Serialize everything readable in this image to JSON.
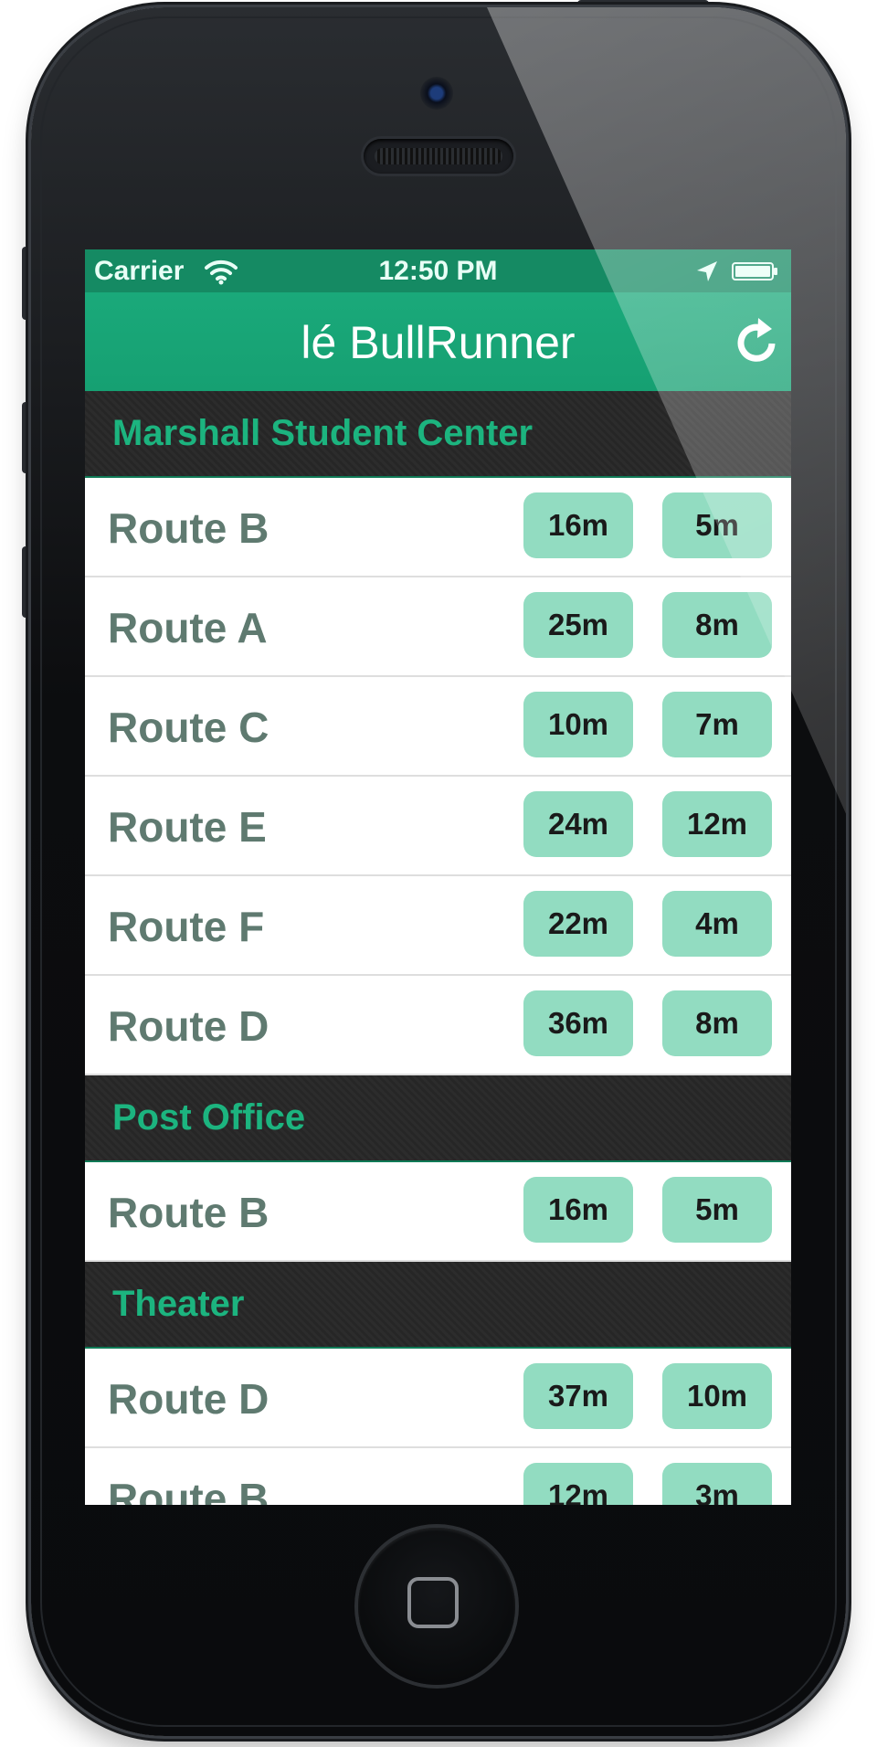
{
  "status_bar": {
    "carrier": "Carrier",
    "time": "12:50 PM"
  },
  "nav": {
    "title": "lé BullRunner"
  },
  "colors": {
    "accent": "#1aa97a",
    "pill": "#92dcc1",
    "header_text": "#1cb47f",
    "route_text": "#5f7a70"
  },
  "icons": [
    "wifi-icon",
    "location-arrow-icon",
    "battery-icon",
    "refresh-icon"
  ],
  "sections": [
    {
      "name": "Marshall Student Center",
      "routes": [
        {
          "route": "Route B",
          "eta1": "16m",
          "eta2": "5m"
        },
        {
          "route": "Route A",
          "eta1": "25m",
          "eta2": "8m"
        },
        {
          "route": "Route C",
          "eta1": "10m",
          "eta2": "7m"
        },
        {
          "route": "Route E",
          "eta1": "24m",
          "eta2": "12m"
        },
        {
          "route": "Route F",
          "eta1": "22m",
          "eta2": "4m"
        },
        {
          "route": "Route D",
          "eta1": "36m",
          "eta2": "8m"
        }
      ]
    },
    {
      "name": "Post Office",
      "routes": [
        {
          "route": "Route B",
          "eta1": "16m",
          "eta2": "5m"
        }
      ]
    },
    {
      "name": "Theater",
      "routes": [
        {
          "route": "Route D",
          "eta1": "37m",
          "eta2": "10m"
        },
        {
          "route": "Route B",
          "eta1": "12m",
          "eta2": "3m"
        }
      ]
    }
  ]
}
